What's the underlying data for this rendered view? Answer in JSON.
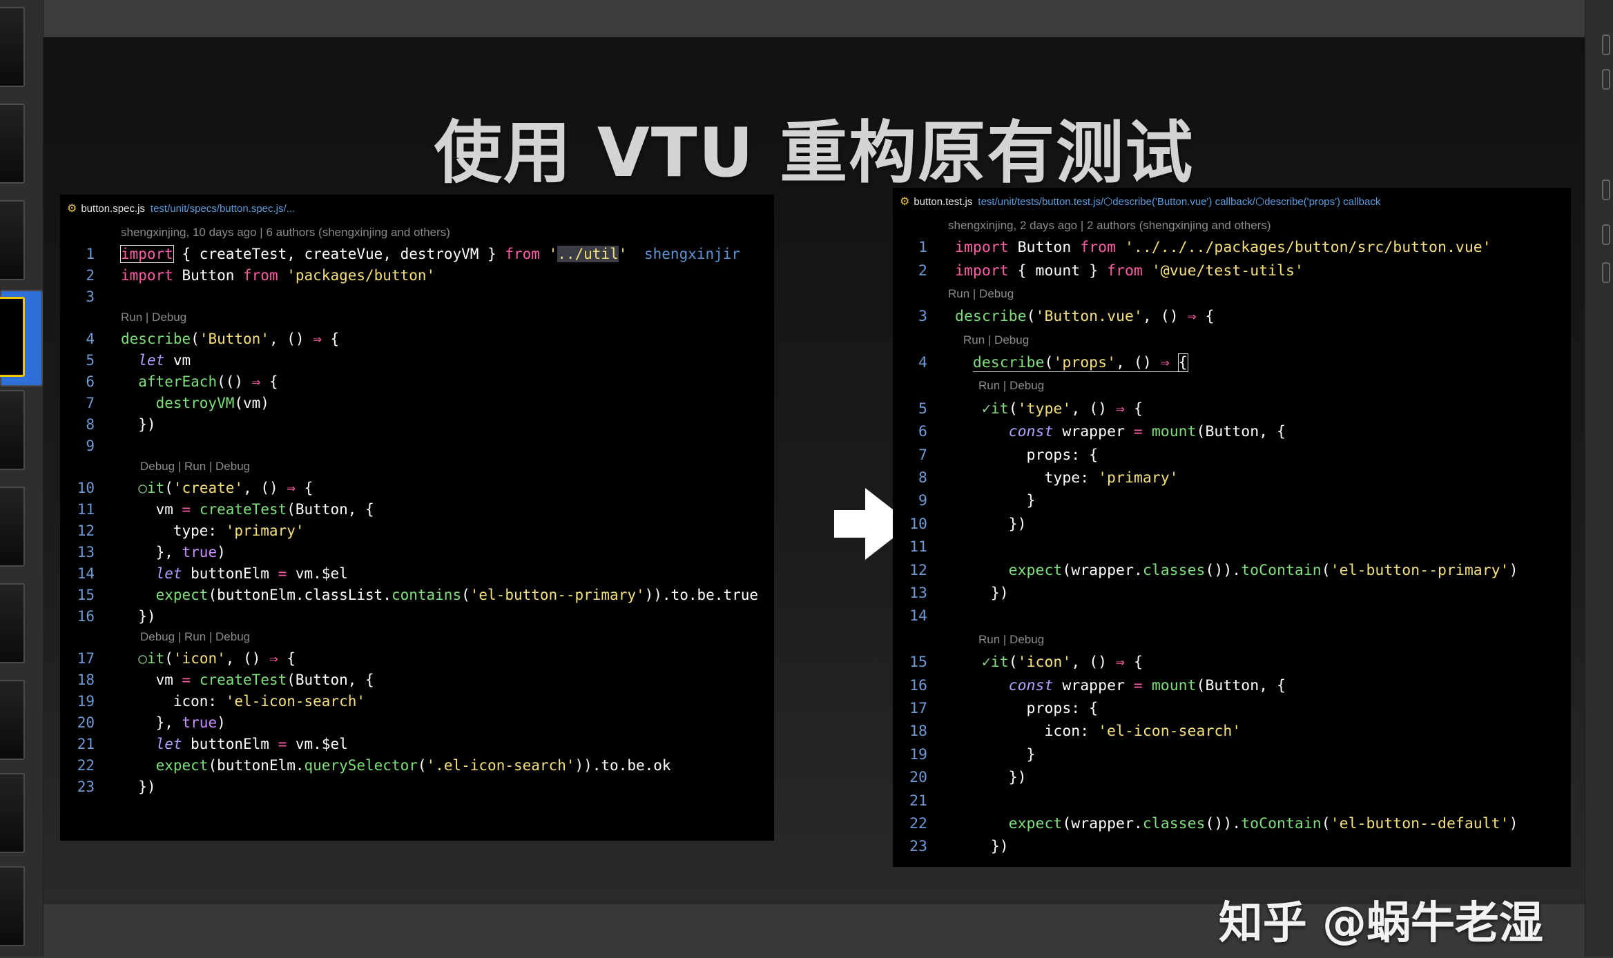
{
  "slide": {
    "title": "使用 VTU 重构原有测试",
    "watermark": "知乎 @蜗牛老湿"
  },
  "left_editor": {
    "tab": {
      "file": "button.spec.js",
      "path": "test/unit/specs/button.spec.js/..."
    },
    "blame": "shengxinjing, 10 days ago | 6 authors (shengxinjing and others)",
    "ghost_text": "shengxinjir",
    "lens": {
      "run_debug": "Run | Debug",
      "debug_run_debug": "Debug | Run | Debug"
    },
    "lines": [
      {
        "n": "1",
        "parts": [
          [
            "import",
            "k boxed"
          ],
          [
            " { ",
            "p"
          ],
          [
            "createTest",
            "p"
          ],
          [
            ", ",
            "p"
          ],
          [
            "createVue",
            "p"
          ],
          [
            ", ",
            "p"
          ],
          [
            "destroyVM",
            "p"
          ],
          [
            " } ",
            "p"
          ],
          [
            "from",
            "k"
          ],
          [
            " '",
            "s"
          ],
          [
            "../util",
            "s hl"
          ],
          [
            "'",
            "s"
          ]
        ],
        "ghost": true
      },
      {
        "n": "2",
        "parts": [
          [
            "import",
            "k"
          ],
          [
            " Button ",
            "p"
          ],
          [
            "from",
            "k"
          ],
          [
            " 'packages/button'",
            "s"
          ]
        ]
      },
      {
        "n": "3",
        "parts": []
      },
      {
        "lens": "run_debug"
      },
      {
        "n": "4",
        "parts": [
          [
            "describe",
            "f"
          ],
          [
            "(",
            "p"
          ],
          [
            "'Button'",
            "s"
          ],
          [
            ", () ",
            "p"
          ],
          [
            "⇒",
            "o"
          ],
          [
            " {",
            "p"
          ]
        ]
      },
      {
        "n": "5",
        "parts": [
          [
            "  ",
            "p"
          ],
          [
            "let",
            "i"
          ],
          [
            " vm",
            "p"
          ]
        ]
      },
      {
        "n": "6",
        "parts": [
          [
            "  ",
            "p"
          ],
          [
            "afterEach",
            "f"
          ],
          [
            "(() ",
            "p"
          ],
          [
            "⇒",
            "o"
          ],
          [
            " {",
            "p"
          ]
        ]
      },
      {
        "n": "7",
        "parts": [
          [
            "    ",
            "p"
          ],
          [
            "destroyVM",
            "f"
          ],
          [
            "(vm)",
            "p"
          ]
        ]
      },
      {
        "n": "8",
        "parts": [
          [
            "  })",
            "p"
          ]
        ]
      },
      {
        "n": "9",
        "parts": []
      },
      {
        "lens": "debug_run_debug"
      },
      {
        "n": "10",
        "parts": [
          [
            "  ",
            "p"
          ],
          [
            "○",
            "mark"
          ],
          [
            "it",
            "f"
          ],
          [
            "(",
            "p"
          ],
          [
            "'create'",
            "s"
          ],
          [
            ", () ",
            "p"
          ],
          [
            "⇒",
            "o"
          ],
          [
            " {",
            "p"
          ]
        ]
      },
      {
        "n": "11",
        "parts": [
          [
            "    vm ",
            "p"
          ],
          [
            "=",
            "o"
          ],
          [
            " ",
            "p"
          ],
          [
            "createTest",
            "f"
          ],
          [
            "(Button, {",
            "p"
          ]
        ]
      },
      {
        "n": "12",
        "parts": [
          [
            "      type: ",
            "p"
          ],
          [
            "'primary'",
            "s"
          ]
        ]
      },
      {
        "n": "13",
        "parts": [
          [
            "    }, ",
            "p"
          ],
          [
            "true",
            "t"
          ],
          [
            ")",
            "p"
          ]
        ]
      },
      {
        "n": "14",
        "parts": [
          [
            "    ",
            "p"
          ],
          [
            "let",
            "i"
          ],
          [
            " buttonElm ",
            "p"
          ],
          [
            "=",
            "o"
          ],
          [
            " vm.$el",
            "p"
          ]
        ]
      },
      {
        "n": "15",
        "parts": [
          [
            "    ",
            "p"
          ],
          [
            "expect",
            "f"
          ],
          [
            "(buttonElm.classList.",
            "p"
          ],
          [
            "contains",
            "f"
          ],
          [
            "(",
            "p"
          ],
          [
            "'el-button--primary'",
            "s"
          ],
          [
            ")).to.be.true",
            "p"
          ]
        ]
      },
      {
        "n": "16",
        "parts": [
          [
            "  })",
            "p"
          ]
        ]
      },
      {
        "lens": "debug_run_debug"
      },
      {
        "n": "17",
        "parts": [
          [
            "  ",
            "p"
          ],
          [
            "○",
            "mark"
          ],
          [
            "it",
            "f"
          ],
          [
            "(",
            "p"
          ],
          [
            "'icon'",
            "s"
          ],
          [
            ", () ",
            "p"
          ],
          [
            "⇒",
            "o"
          ],
          [
            " {",
            "p"
          ]
        ]
      },
      {
        "n": "18",
        "parts": [
          [
            "    vm ",
            "p"
          ],
          [
            "=",
            "o"
          ],
          [
            " ",
            "p"
          ],
          [
            "createTest",
            "f"
          ],
          [
            "(Button, {",
            "p"
          ]
        ]
      },
      {
        "n": "19",
        "parts": [
          [
            "      icon: ",
            "p"
          ],
          [
            "'el-icon-search'",
            "s"
          ]
        ]
      },
      {
        "n": "20",
        "parts": [
          [
            "    }, ",
            "p"
          ],
          [
            "true",
            "t"
          ],
          [
            ")",
            "p"
          ]
        ]
      },
      {
        "n": "21",
        "parts": [
          [
            "    ",
            "p"
          ],
          [
            "let",
            "i"
          ],
          [
            " buttonElm ",
            "p"
          ],
          [
            "=",
            "o"
          ],
          [
            " vm.$el",
            "p"
          ]
        ]
      },
      {
        "n": "22",
        "parts": [
          [
            "    ",
            "p"
          ],
          [
            "expect",
            "f"
          ],
          [
            "(buttonElm.",
            "p"
          ],
          [
            "querySelector",
            "f"
          ],
          [
            "(",
            "p"
          ],
          [
            "'.el-icon-search'",
            "s"
          ],
          [
            ")).to.be.ok",
            "p"
          ]
        ]
      },
      {
        "n": "23",
        "parts": [
          [
            "  })",
            "p"
          ]
        ]
      }
    ]
  },
  "right_editor": {
    "tab": {
      "file": "button.test.js",
      "path": "test/unit/tests/button.test.js/",
      "crumb1": "describe('Button.vue') callback/",
      "crumb2": "describe('props') callback"
    },
    "blame": "shengxinjing, 2 days ago | 2 authors (shengxinjing and others)",
    "lens": {
      "run_debug": "Run | Debug"
    },
    "lines": [
      {
        "n": "1",
        "parts": [
          [
            "import",
            "k"
          ],
          [
            " Button ",
            "p"
          ],
          [
            "from",
            "k"
          ],
          [
            " '../../../packages/button/src/button.vue'",
            "s"
          ]
        ]
      },
      {
        "n": "2",
        "parts": [
          [
            "import",
            "k"
          ],
          [
            " { ",
            "p"
          ],
          [
            "mount",
            "p"
          ],
          [
            " } ",
            "p"
          ],
          [
            "from",
            "k"
          ],
          [
            " '@vue/test-utils'",
            "s"
          ]
        ]
      },
      {
        "lens": "run_debug",
        "indent": 0
      },
      {
        "n": "3",
        "parts": [
          [
            "describe",
            "f"
          ],
          [
            "(",
            "p"
          ],
          [
            "'Button.vue'",
            "s"
          ],
          [
            ", () ",
            "p"
          ],
          [
            "⇒",
            "o"
          ],
          [
            " {",
            "p"
          ]
        ]
      },
      {
        "lens": "run_debug",
        "indent": 1
      },
      {
        "n": "4",
        "parts": [
          [
            "  ",
            "p"
          ],
          [
            "describe",
            "f u"
          ],
          [
            "(",
            "p u"
          ],
          [
            "'props'",
            "s u"
          ],
          [
            ", () ",
            "p u"
          ],
          [
            "⇒",
            "o u"
          ],
          [
            " ",
            "p u"
          ],
          [
            "{",
            "p boxed"
          ]
        ]
      },
      {
        "lens": "run_debug",
        "indent": 2
      },
      {
        "n": "5",
        "parts": [
          [
            "   ",
            "p"
          ],
          [
            "✓",
            "mark"
          ],
          [
            "it",
            "f"
          ],
          [
            "(",
            "p"
          ],
          [
            "'type'",
            "s"
          ],
          [
            ", () ",
            "p"
          ],
          [
            "⇒",
            "o"
          ],
          [
            " {",
            "p"
          ]
        ]
      },
      {
        "n": "6",
        "parts": [
          [
            "      ",
            "p"
          ],
          [
            "const",
            "i"
          ],
          [
            " wrapper ",
            "p"
          ],
          [
            "=",
            "o"
          ],
          [
            " ",
            "p"
          ],
          [
            "mount",
            "f"
          ],
          [
            "(Button, {",
            "p"
          ]
        ]
      },
      {
        "n": "7",
        "parts": [
          [
            "        props: {",
            "p"
          ]
        ]
      },
      {
        "n": "8",
        "parts": [
          [
            "          type: ",
            "p"
          ],
          [
            "'primary'",
            "s"
          ]
        ]
      },
      {
        "n": "9",
        "parts": [
          [
            "        }",
            "p"
          ]
        ]
      },
      {
        "n": "10",
        "parts": [
          [
            "      })",
            "p"
          ]
        ]
      },
      {
        "n": "11",
        "parts": []
      },
      {
        "n": "12",
        "parts": [
          [
            "      ",
            "p"
          ],
          [
            "expect",
            "f"
          ],
          [
            "(wrapper.",
            "p"
          ],
          [
            "classes",
            "f"
          ],
          [
            "()).",
            "p"
          ],
          [
            "toContain",
            "f"
          ],
          [
            "(",
            "p"
          ],
          [
            "'el-button--primary'",
            "s"
          ],
          [
            ")",
            "p"
          ]
        ]
      },
      {
        "n": "13",
        "parts": [
          [
            "    })",
            "p"
          ]
        ]
      },
      {
        "n": "14",
        "parts": []
      },
      {
        "lens": "run_debug",
        "indent": 2
      },
      {
        "n": "15",
        "parts": [
          [
            "   ",
            "p"
          ],
          [
            "✓",
            "mark"
          ],
          [
            "it",
            "f"
          ],
          [
            "(",
            "p"
          ],
          [
            "'icon'",
            "s"
          ],
          [
            ", () ",
            "p"
          ],
          [
            "⇒",
            "o"
          ],
          [
            " {",
            "p"
          ]
        ]
      },
      {
        "n": "16",
        "parts": [
          [
            "      ",
            "p"
          ],
          [
            "const",
            "i"
          ],
          [
            " wrapper ",
            "p"
          ],
          [
            "=",
            "o"
          ],
          [
            " ",
            "p"
          ],
          [
            "mount",
            "f"
          ],
          [
            "(Button, {",
            "p"
          ]
        ]
      },
      {
        "n": "17",
        "parts": [
          [
            "        props: {",
            "p"
          ]
        ]
      },
      {
        "n": "18",
        "parts": [
          [
            "          icon: ",
            "p"
          ],
          [
            "'el-icon-search'",
            "s"
          ]
        ]
      },
      {
        "n": "19",
        "parts": [
          [
            "        }",
            "p"
          ]
        ]
      },
      {
        "n": "20",
        "parts": [
          [
            "      })",
            "p"
          ]
        ]
      },
      {
        "n": "21",
        "parts": []
      },
      {
        "n": "22",
        "parts": [
          [
            "      ",
            "p"
          ],
          [
            "expect",
            "f"
          ],
          [
            "(wrapper.",
            "p"
          ],
          [
            "classes",
            "f"
          ],
          [
            "()).",
            "p"
          ],
          [
            "toContain",
            "f"
          ],
          [
            "(",
            "p"
          ],
          [
            "'el-button--default'",
            "s"
          ],
          [
            ")",
            "p"
          ]
        ]
      },
      {
        "n": "23",
        "parts": [
          [
            "    })",
            "p"
          ]
        ]
      }
    ]
  },
  "icons": {
    "arrow": "arrow-right-icon",
    "tab_file": "js-file-icon",
    "breadcrumb": "cube-icon"
  }
}
